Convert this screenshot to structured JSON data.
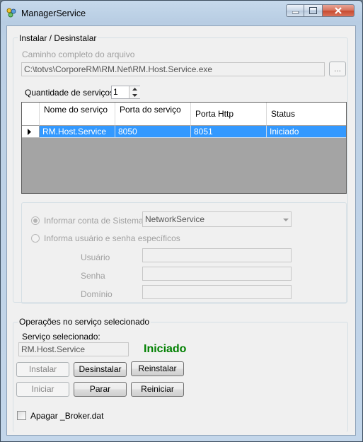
{
  "window": {
    "title": "ManagerService",
    "buttons": {
      "minimize": "minimize-icon",
      "maximize": "maximize-icon",
      "close": "close-icon"
    }
  },
  "install_group": {
    "title": "Instalar / Desinstalar",
    "path_label": "Caminho completo do arquivo",
    "path_value": "C:\\totvs\\CorporeRM\\RM.Net\\RM.Host.Service.exe",
    "browse_label": "...",
    "quantity_label": "Quantidade de serviços",
    "quantity_value": "1"
  },
  "grid": {
    "columns": [
      "Nome do serviço",
      "Porta do serviço",
      "Porta Http",
      "Status"
    ],
    "rows": [
      {
        "name": "RM.Host.Service",
        "port": "8050",
        "http_port": "8051",
        "status": "Iniciado"
      }
    ]
  },
  "account_group": {
    "option_system": "Informar conta de Sistema",
    "option_specific": "Informa usuário e senha específicos",
    "system_account_value": "NetworkService",
    "user_label": "Usuário",
    "password_label": "Senha",
    "domain_label": "Domínio"
  },
  "operations_group": {
    "title": "Operações no serviço selecionado",
    "selected_label": "Serviço selecionado:",
    "selected_value": "RM.Host.Service",
    "status_text": "Iniciado",
    "status_color": "#008000",
    "install": "Instalar",
    "uninstall": "Desinstalar",
    "reinstall": "Reinstalar",
    "start": "Iniciar",
    "stop": "Parar",
    "restart": "Reiniciar",
    "delete_broker_label": "Apagar _Broker.dat"
  }
}
